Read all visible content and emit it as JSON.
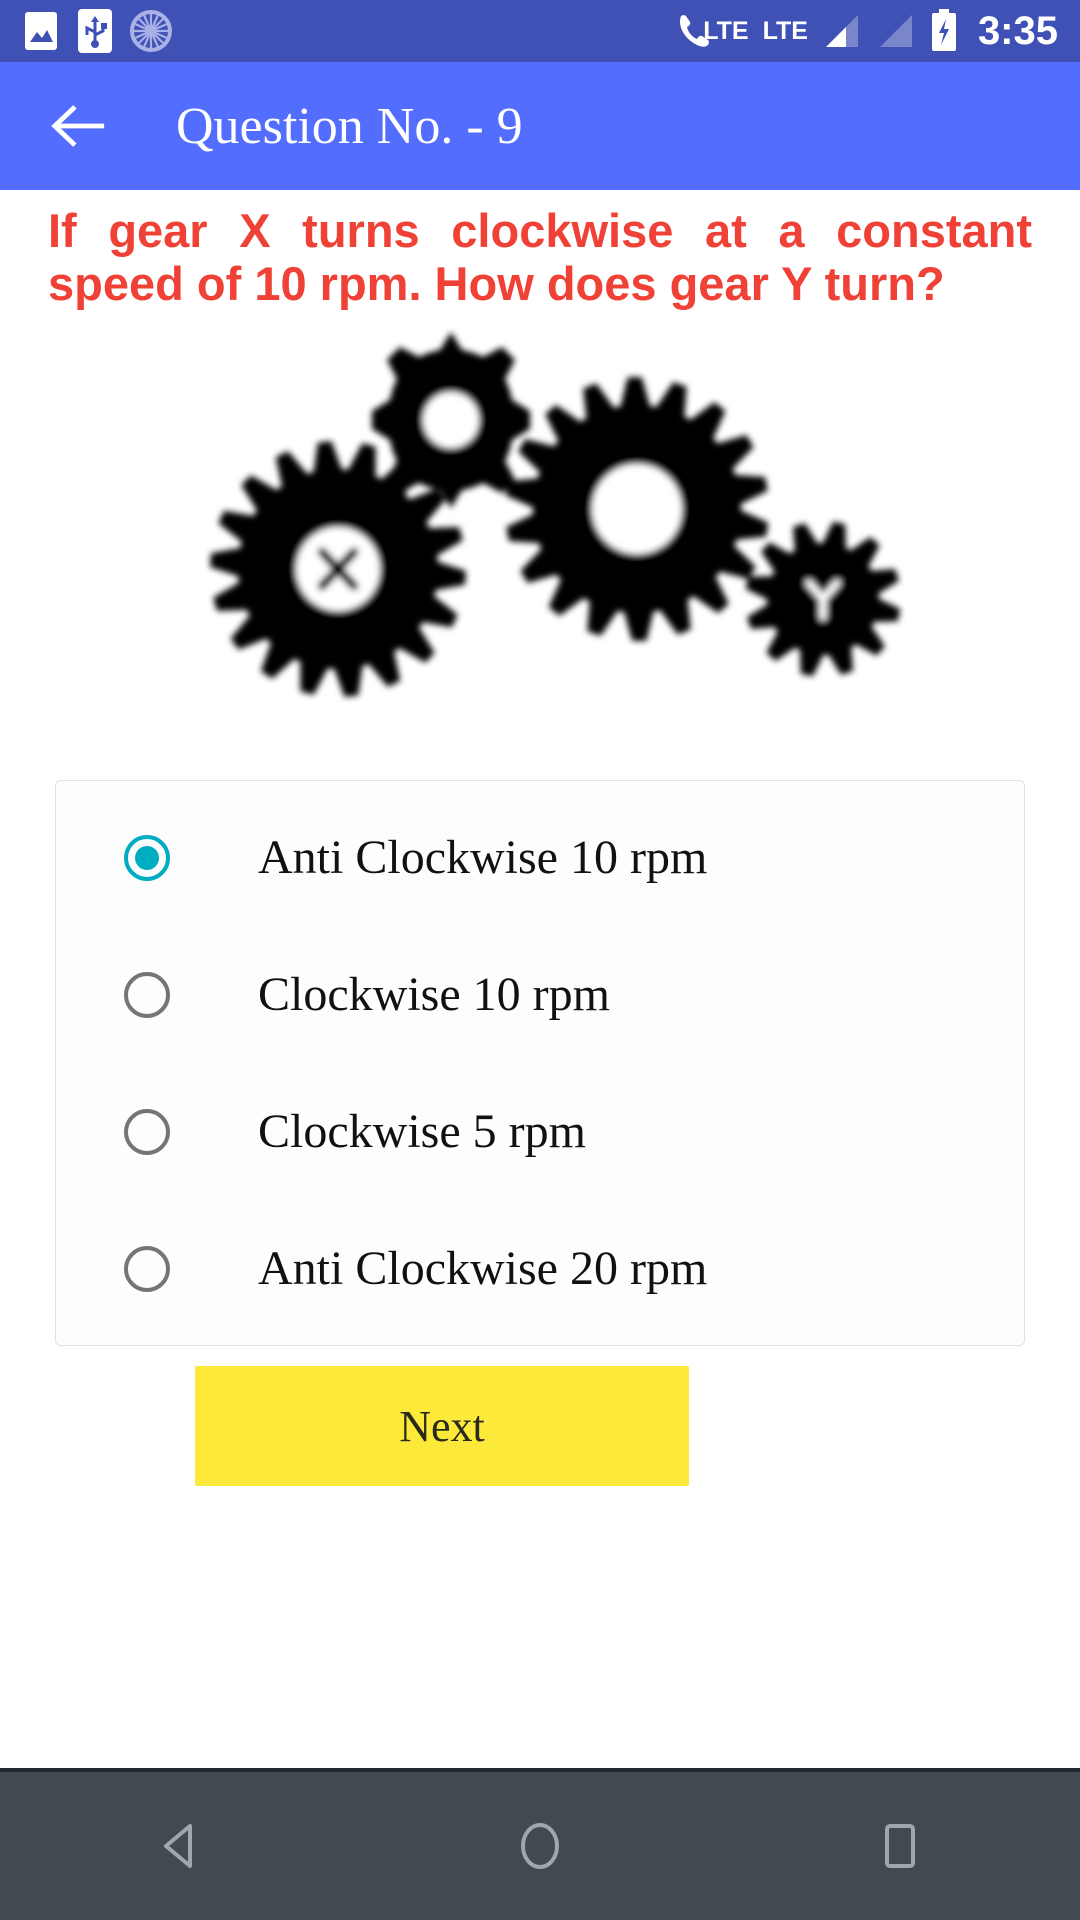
{
  "status_bar": {
    "background_color": "#3F51B5",
    "left_icons": [
      "image-icon",
      "usb-icon",
      "ashoka-chakra-icon"
    ],
    "network_label_1": "LTE",
    "network_label_2": "LTE",
    "right_icons": [
      "phone-lte-icon",
      "signal-bar-icon",
      "signal-bar-empty-icon",
      "battery-charging-icon"
    ],
    "clock": "3:35"
  },
  "app_bar": {
    "background_color": "#536DFE",
    "back_icon": "arrow-left-icon",
    "title": "Question No. - 9"
  },
  "question": {
    "text": "If gear X turns clockwise at a constant speed of 10 rpm. How does gear Y turn?",
    "color": "#EF4136"
  },
  "figure": {
    "name": "gear-train-diagram",
    "gear_labels": [
      "X",
      "Y"
    ],
    "description": "Four meshing gears, large gear labelled X at left, small gear labelled Y at right"
  },
  "options": {
    "selected_index": 0,
    "selected_color": "#00ACC1",
    "unselected_color": "#757575",
    "items": [
      {
        "label": "Anti Clockwise 10 rpm",
        "selected": true
      },
      {
        "label": "Clockwise 10 rpm",
        "selected": false
      },
      {
        "label": "Clockwise 5 rpm",
        "selected": false
      },
      {
        "label": "Anti Clockwise 20 rpm",
        "selected": false
      }
    ]
  },
  "next_button": {
    "label": "Next",
    "background_color": "#FCE93A",
    "text_color": "#2A2A1C"
  },
  "nav_bar": {
    "background_color": "#434A4F",
    "buttons": [
      "back-triangle-icon",
      "home-circle-icon",
      "recents-square-icon"
    ]
  }
}
